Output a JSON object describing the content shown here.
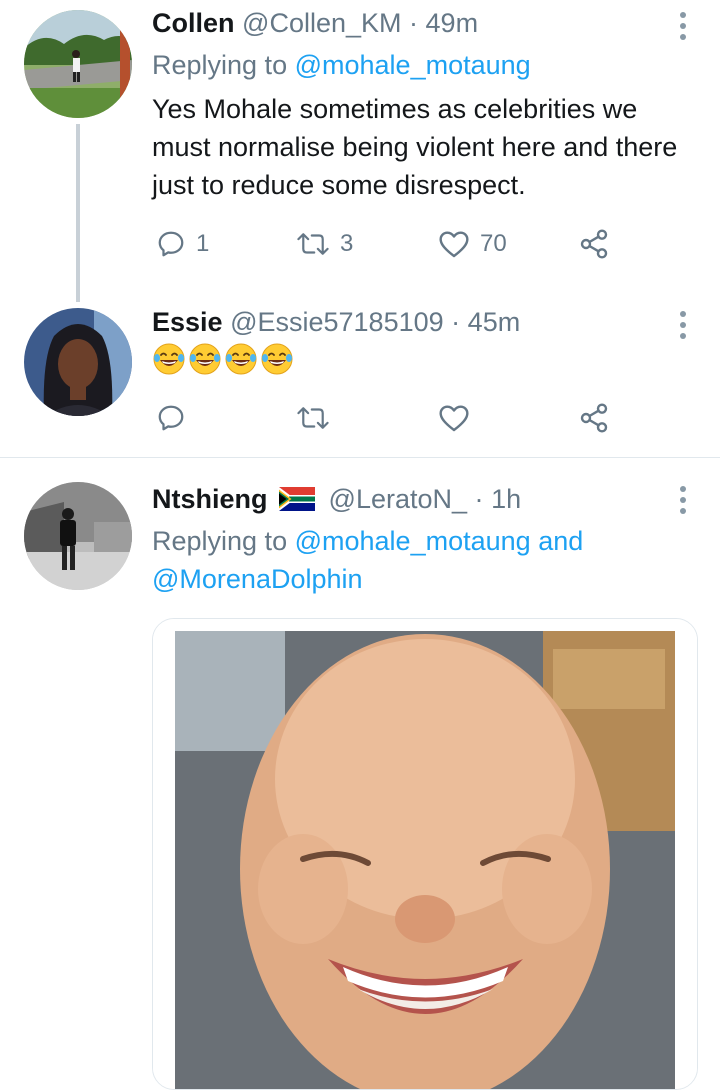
{
  "tweets": [
    {
      "name": "Collen",
      "handle": "@Collen_KM",
      "time": "49m",
      "replying_label": "Replying to",
      "replying_user": "@mohale_motaung",
      "text": "Yes Mohale sometimes as celebrities we must normalise being violent here and there just to reduce some disrespect.",
      "replies": "1",
      "retweets": "3",
      "likes": "70"
    },
    {
      "name": "Essie",
      "handle": "@Essie57185109",
      "time": "45m",
      "text_emoji": "😂😂😂😂"
    },
    {
      "name": "Ntshieng",
      "handle": "@LeratoN_",
      "time": "1h",
      "replying_label": "Replying to",
      "replying_user_1": "@mohale_motaung",
      "replying_and": "and",
      "replying_user_2": "@MorenaDolphin"
    }
  ],
  "colors": {
    "accent": "#1da1f2",
    "muted": "#657786",
    "text": "#14171a",
    "divider": "#e1e8ed"
  },
  "icons": [
    "more-vertical-icon",
    "reply-icon",
    "retweet-icon",
    "like-icon",
    "share-icon",
    "south-africa-flag-icon",
    "laughing-emoji-icon"
  ]
}
